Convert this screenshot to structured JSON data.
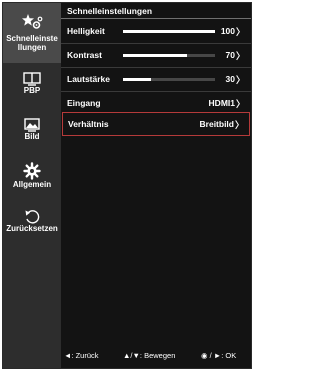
{
  "sidebar": {
    "items": [
      {
        "label_lines": [
          "Schnelleinste",
          "llungen"
        ],
        "icon": "star-gears-icon",
        "active": true
      },
      {
        "label": "PBP",
        "icon": "pbp-monitor-icon"
      },
      {
        "label": "Bild",
        "icon": "picture-icon"
      },
      {
        "label": "Allgemein",
        "icon": "gear-icon"
      },
      {
        "label": "Zurücksetzen",
        "icon": "reset-icon"
      }
    ]
  },
  "main": {
    "title": "Schnelleinstellungen",
    "rows": [
      {
        "label": "Helligkeit",
        "value": "100",
        "level": 1.0
      },
      {
        "label": "Kontrast",
        "value": "70",
        "level": 0.7
      },
      {
        "label": "Lautstärke",
        "value": "30",
        "level": 0.3
      },
      {
        "label": "Eingang",
        "value": "HDMI1"
      },
      {
        "label": "Verhältnis",
        "value": "Breitbild",
        "selected": true
      }
    ],
    "chevron": "〉"
  },
  "footer": {
    "back": "◄: Zurück",
    "move": "▲/▼: Bewegen",
    "ok": "◉ / ►: OK"
  },
  "colors": {
    "background": "#131313",
    "sidebar": "#2d2d2d",
    "active_tab": "#4a4a4a",
    "selection": "#b53a3a"
  }
}
